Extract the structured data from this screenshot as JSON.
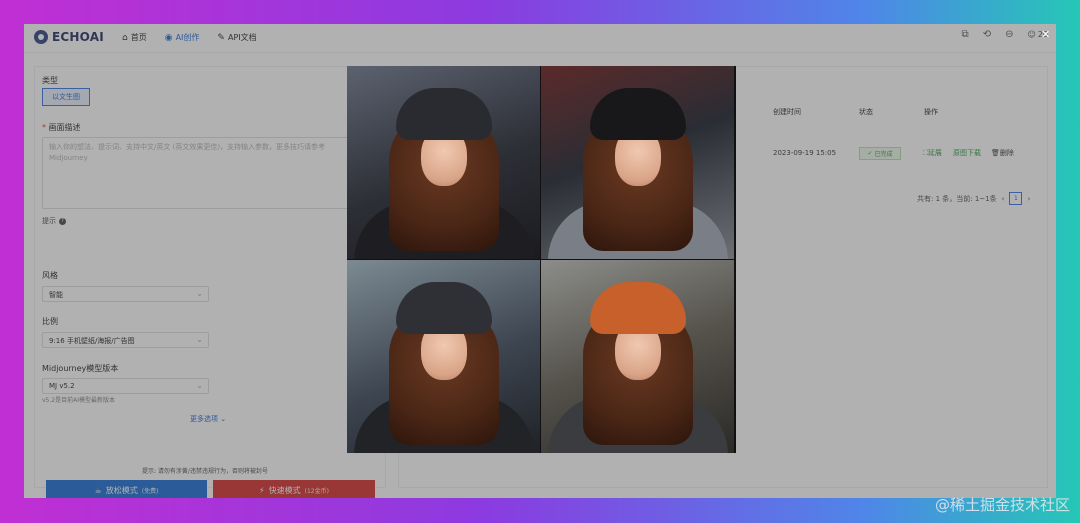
{
  "app": {
    "logo_text": "ECHOAI"
  },
  "nav": [
    {
      "label": "首页",
      "icon": "home-icon"
    },
    {
      "label": "AI创作",
      "icon": "ai-icon"
    },
    {
      "label": "API文档",
      "icon": "wrench-icon"
    }
  ],
  "top": {
    "badge": "20"
  },
  "form": {
    "type_label": "类型",
    "type_button": "以文生图",
    "desc_label": "画面描述",
    "desc_placeholder": "输入你的想法、提示词、支持中文/英文 (英文效果更佳)，支持输入参数，更多技巧请参考Midjourney",
    "hint_label": "提示",
    "style_label": "风格",
    "style_value": "智能",
    "ratio_label": "比例",
    "ratio_value": "9:16 手机壁纸/海报/广告图",
    "model_label": "Midjourney模型版本",
    "model_value": "MJ v5.2",
    "model_note": "v5.2是目前AI模型最新版本",
    "more_options": "更多选项",
    "warning": "提示: 请勿有涉黄/违禁违规行为，否则将被封号",
    "relax_btn": "放松模式",
    "relax_sub": "(免费)",
    "fast_btn": "快速模式",
    "fast_sub": "(12金币)"
  },
  "table": {
    "headers": [
      "创建时间",
      "状态",
      "操作"
    ],
    "row": {
      "date": "2023-09-19 15:05",
      "status": "已完成",
      "ops": [
        "延展",
        "原图下载",
        "删除"
      ]
    },
    "pager_text": "共有: 1 条，当前: 1~1条",
    "page": "1"
  },
  "watermark": "@稀土掘金技术社区",
  "colors": {
    "accent": "#2f6fd6",
    "danger": "#d93a3a",
    "primary_btn": "#2876d8",
    "success": "#3aa34a"
  }
}
